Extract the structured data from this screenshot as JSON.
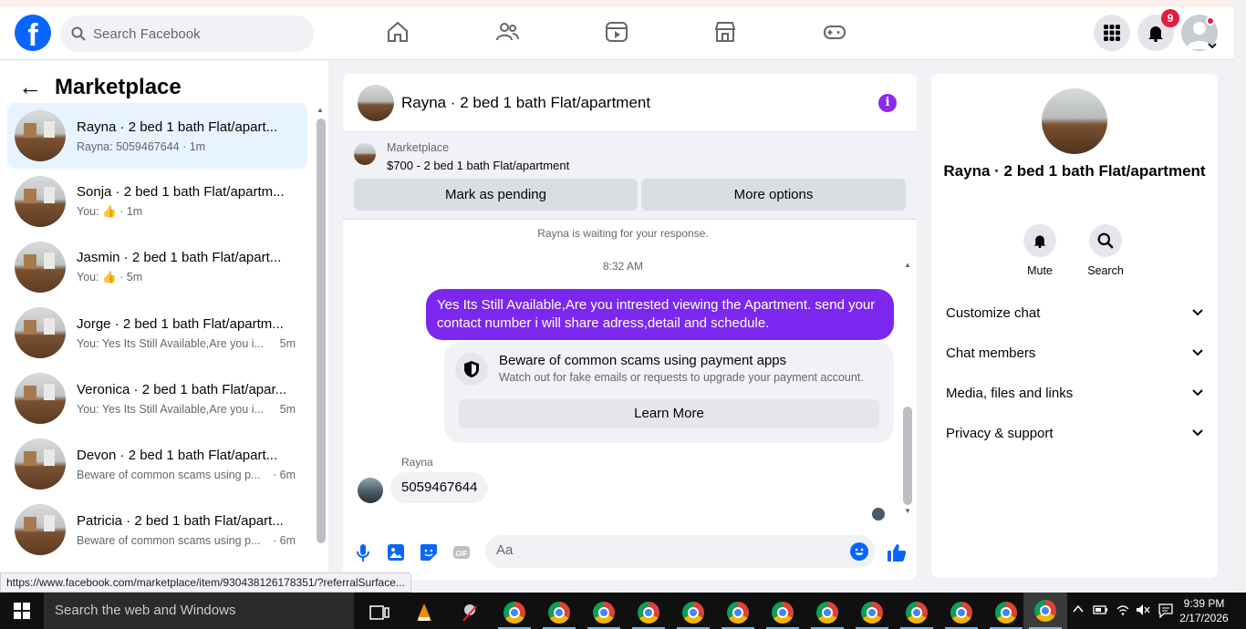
{
  "topbar": {
    "logo": "f",
    "search_placeholder": "Search Facebook",
    "notification_count": "9"
  },
  "sidebar": {
    "title": "Marketplace",
    "conversations": [
      {
        "name": "Rayna · 2 bed 1 bath Flat/apart...",
        "sub": "Rayna: 5059467644 · 1m"
      },
      {
        "name": "Sonja · 2 bed 1 bath Flat/apartm...",
        "sub_prefix": "You:",
        "sub_time": "· 1m"
      },
      {
        "name": "Jasmin · 2 bed 1 bath Flat/apart...",
        "sub_prefix": "You:",
        "sub_time": "· 5m"
      },
      {
        "name": "Jorge · 2 bed 1 bath Flat/apartm...",
        "sub": "You: Yes Its Still Available,Are you i...",
        "time": "5m"
      },
      {
        "name": "Veronica · 2 bed 1 bath Flat/apar...",
        "sub": "You: Yes Its Still Available,Are you i...",
        "time": "5m"
      },
      {
        "name": "Devon · 2 bed 1 bath Flat/apart...",
        "sub": "Beware of common scams using p...",
        "time": "· 6m"
      },
      {
        "name": "Patricia · 2 bed 1 bath Flat/apart...",
        "sub": "Beware of common scams using p...",
        "time": "· 6m"
      }
    ]
  },
  "chat": {
    "title": "Rayna · 2 bed 1 bath Flat/apartment",
    "marketplace_label": "Marketplace",
    "listing": "$700 - 2 bed 1 bath Flat/apartment",
    "mark_pending": "Mark as pending",
    "more_options": "More options",
    "waiting": "Rayna is waiting for your response.",
    "time": "8:32 AM",
    "my_message": "Yes Its Still Available,Are you intrested viewing the Apartment. send your contact number i will share adress,detail and schedule.",
    "scam_title": "Beware of common scams using payment apps",
    "scam_text": "Watch out for fake emails or requests to upgrade your payment account.",
    "learn_more": "Learn More",
    "sender": "Rayna",
    "their_message": "5059467644",
    "composer_placeholder": "Aa"
  },
  "rpanel": {
    "name": "Rayna · 2 bed 1 bath Flat/apartment",
    "mute": "Mute",
    "search": "Search",
    "items": [
      "Customize chat",
      "Chat members",
      "Media, files and links",
      "Privacy & support"
    ]
  },
  "status_url": "https://www.facebook.com/marketplace/item/930438126178351/?referralSurface...",
  "taskbar": {
    "search_placeholder": "Search the web and Windows",
    "time": "9:39 PM",
    "date": "2/17/2026"
  },
  "colors": {
    "fb_blue": "#0866ff",
    "message_purple": "#7b27f0",
    "badge_red": "#e41e3f"
  }
}
